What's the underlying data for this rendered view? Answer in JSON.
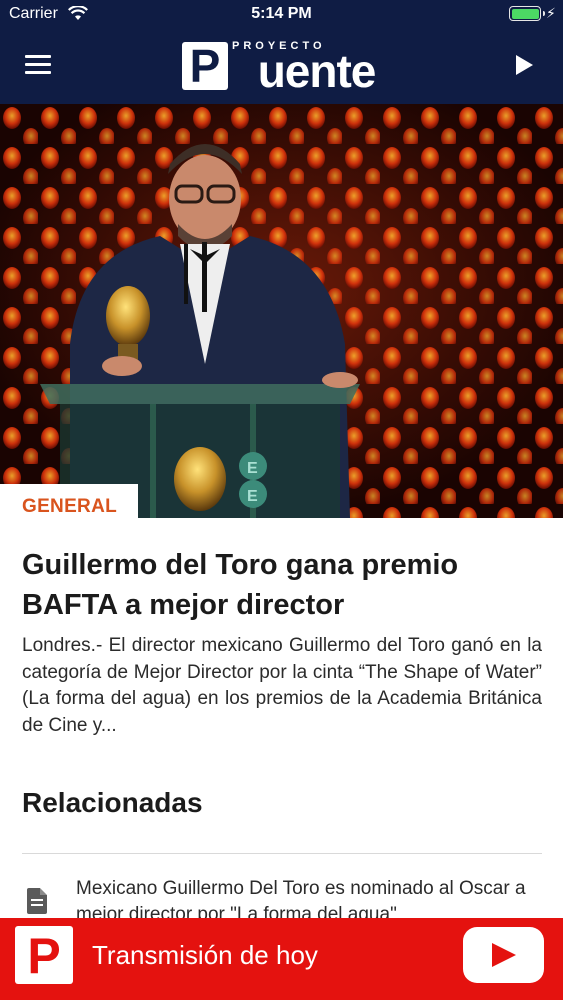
{
  "status_bar": {
    "carrier": "Carrier",
    "time": "5:14 PM",
    "wifi_icon": "wifi-icon",
    "battery_icon": "battery-full-icon",
    "charging_icon": "bolt-icon"
  },
  "header": {
    "menu_icon": "hamburger-menu-icon",
    "logo": {
      "kicker": "PROYECTO",
      "wordmark": "Puente"
    },
    "play_icon": "play-icon"
  },
  "article": {
    "image_alt": "Guillermo del Toro speaking at a podium holding a BAFTA award mask",
    "category": "GENERAL",
    "headline": "Guillermo del Toro gana premio BAFTA a mejor director",
    "summary": "Londres.- El director mexicano Guillermo del Toro ganó en la categoría de Mejor Director por la cinta “The Shape of Water” (La forma del agua) en los premios de la Academia Británica de Cine y..."
  },
  "related": {
    "title": "Relacionadas",
    "items": [
      {
        "icon": "document-icon",
        "text": "Mexicano Guillermo Del Toro es nominado al Oscar a mejor director por \"La forma del agua\""
      }
    ]
  },
  "live_bar": {
    "label": "Transmisión de hoy",
    "icon": "puente-app-icon",
    "youtube_icon": "youtube-play-icon"
  },
  "colors": {
    "header_bg": "#0f1c44",
    "category": "#d9541e",
    "live_bar_bg": "#e4120f",
    "battery": "#4cd964"
  }
}
